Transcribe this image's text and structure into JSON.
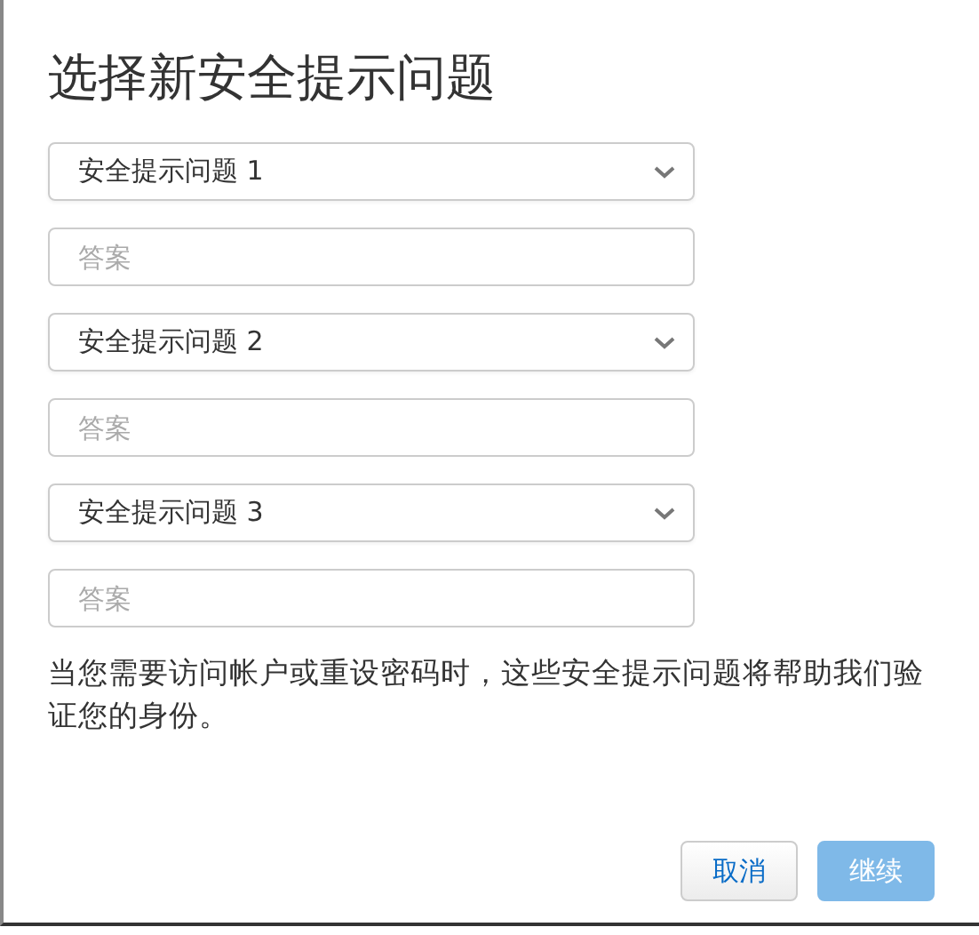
{
  "dialog": {
    "title": "选择新安全提示问题"
  },
  "questions": [
    {
      "question": "安全提示问题 1",
      "answer_placeholder": "答案"
    },
    {
      "question": "安全提示问题 2",
      "answer_placeholder": "答案"
    },
    {
      "question": "安全提示问题 3",
      "answer_placeholder": "答案"
    }
  ],
  "note": "当您需要访问帐户或重设密码时，这些安全提示问题将帮助我们验证您的身份。",
  "buttons": [
    {
      "label": "取消",
      "kind": "secondary",
      "disabled": false
    },
    {
      "label": "继续",
      "kind": "primary",
      "disabled": true
    }
  ]
}
